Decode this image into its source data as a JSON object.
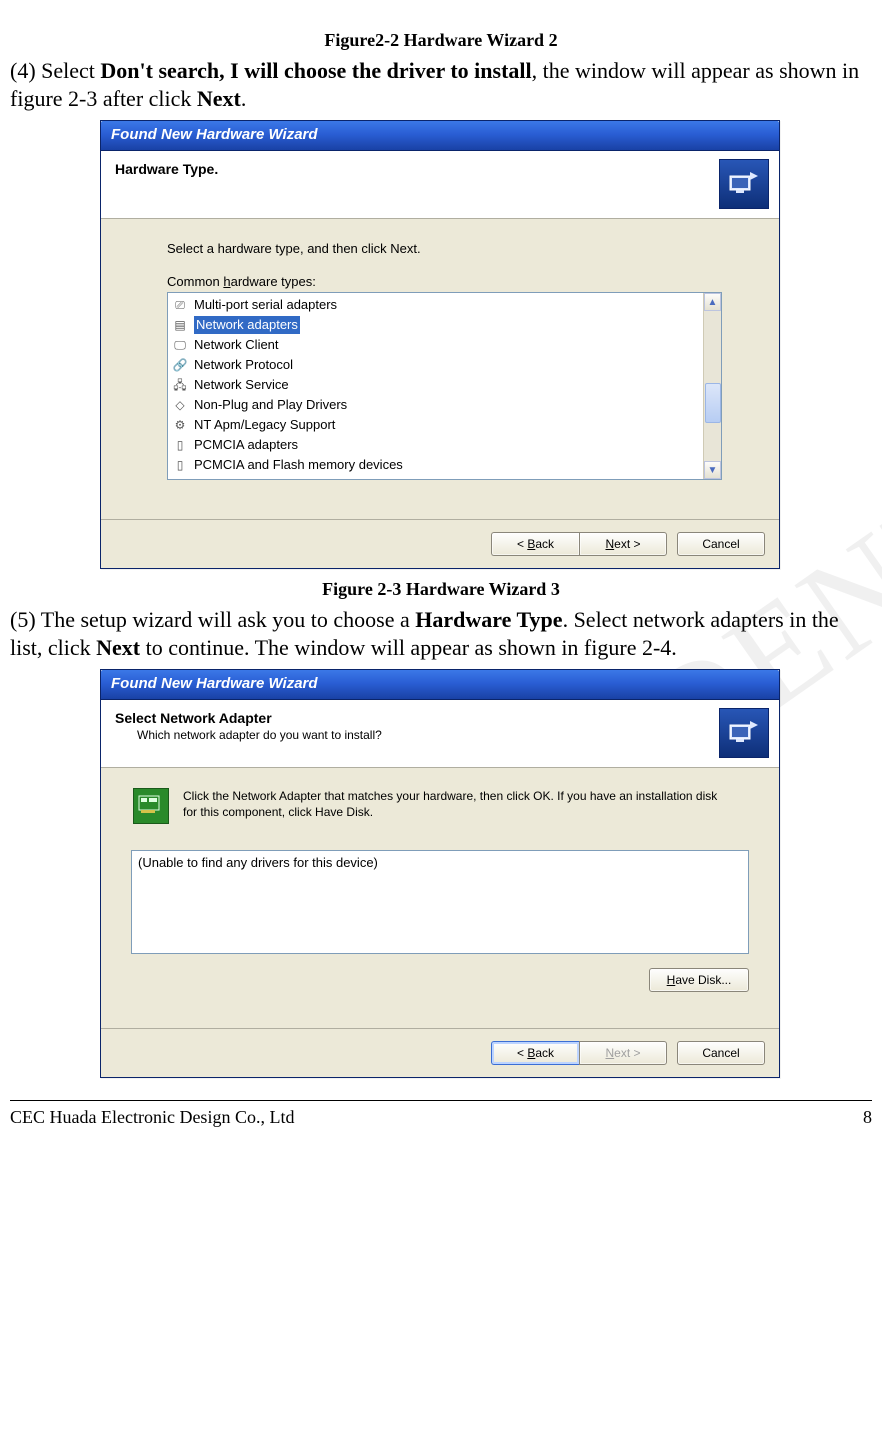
{
  "watermark": "CONFIDENTIAL",
  "captions": {
    "fig22": "Figure2-2 Hardware Wizard 2",
    "fig23": "Figure 2-3 Hardware Wizard 3"
  },
  "step4": {
    "prefix": "(4) Select ",
    "bold1": "Don't search, I will choose the driver to install",
    "mid": ", the window will appear as shown in figure 2-3 after click ",
    "bold2": "Next",
    "suffix": "."
  },
  "step5": {
    "prefix": "(5) The setup wizard will ask you to choose a ",
    "bold1": "Hardware Type",
    "mid1": ". Select network adapters in the list, click ",
    "bold2": "Next",
    "suffix": " to continue. The window will appear as shown in figure 2-4."
  },
  "dialog1": {
    "title": "Found New Hardware Wizard",
    "header": "Hardware Type.",
    "instruction": "Select a hardware type, and then click Next.",
    "listLabelPre": "Common ",
    "listLabelU": "h",
    "listLabelPost": "ardware types:",
    "items": [
      "Multi-port serial adapters",
      "Network adapters",
      "Network Client",
      "Network Protocol",
      "Network Service",
      "Non-Plug and Play Drivers",
      "NT Apm/Legacy Support",
      "PCMCIA adapters",
      "PCMCIA and Flash memory devices"
    ],
    "selectedIndex": 1
  },
  "dialog2": {
    "title": "Found New Hardware Wizard",
    "header": "Select Network Adapter",
    "subheader": "Which network adapter do you want to install?",
    "instruction": "Click the Network Adapter that matches your hardware, then click OK. If you have an installation disk for this component, click Have Disk.",
    "driverMessage": "(Unable to find any drivers for this device)"
  },
  "buttons": {
    "backPre": "< ",
    "backU": "B",
    "backPost": "ack",
    "nextU": "N",
    "nextPost": "ext >",
    "cancel": "Cancel",
    "haveDiskU": "H",
    "haveDiskPost": "ave Disk..."
  },
  "footer": {
    "company": "CEC Huada Electronic Design Co., Ltd",
    "page": "8"
  }
}
